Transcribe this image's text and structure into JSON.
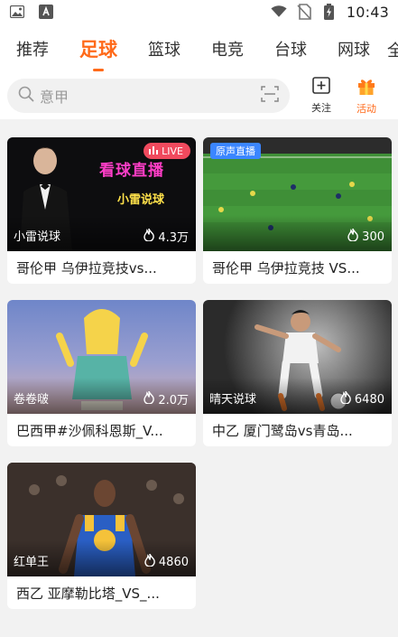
{
  "status_bar": {
    "time": "10:43"
  },
  "top_tabs": [
    {
      "label": "推荐",
      "active": false
    },
    {
      "label": "足球",
      "active": true
    },
    {
      "label": "篮球",
      "active": false
    },
    {
      "label": "电竞",
      "active": false
    },
    {
      "label": "台球",
      "active": false
    },
    {
      "label": "网球",
      "active": false
    }
  ],
  "tab_overflow": "全",
  "search": {
    "placeholder": "意甲"
  },
  "actions": {
    "follow_label": "关注",
    "activity_label": "活动"
  },
  "colors": {
    "accent": "#ff6a1a",
    "live_badge": "#f04a5e",
    "original_badge": "#3b86ff"
  },
  "cards": [
    {
      "anchor": "小雷说球",
      "heat": "4.3万",
      "title": "哥伦甲 乌伊拉竞技vs...",
      "badge": "LIVE",
      "overlay_text_1": "看球直播",
      "overlay_text_2": "小雷说球"
    },
    {
      "anchor": "",
      "heat": "300",
      "title": "哥伦甲 乌伊拉竞技 VS...",
      "badge": "原声直播"
    },
    {
      "anchor": "卷卷啵",
      "heat": "2.0万",
      "title": "巴西甲#沙佩科恩斯_V..."
    },
    {
      "anchor": "晴天说球",
      "heat": "6480",
      "title": "中乙 厦门鹭岛vs青岛..."
    },
    {
      "anchor": "红单王",
      "heat": "4860",
      "title": "西乙 亚摩勒比塔_VS_..."
    }
  ]
}
